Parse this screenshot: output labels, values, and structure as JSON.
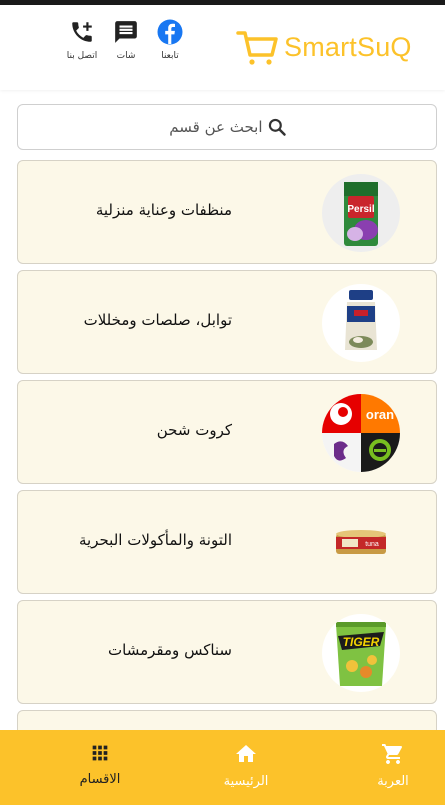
{
  "brand": {
    "name": "SmartSuQ",
    "color": "#fcc22a"
  },
  "header": {
    "actions": [
      {
        "label": "تابعنا",
        "icon": "facebook-icon"
      },
      {
        "label": "شات",
        "icon": "chat-icon"
      },
      {
        "label": "اتصل بنا",
        "icon": "add-call-icon"
      }
    ]
  },
  "search": {
    "placeholder": "ابحث عن قسم",
    "icon": "search-icon"
  },
  "categories": [
    {
      "name": "منظفات وعناية منزلية",
      "image": "detergent-bottle"
    },
    {
      "name": "توابل، صلصات ومخللات",
      "image": "spice-jar"
    },
    {
      "name": "كروت شحن",
      "image": "recharge-cards-logos"
    },
    {
      "name": "التونة والمأكولات البحرية",
      "image": "tuna-can"
    },
    {
      "name": "سناكس ومقرمشات",
      "image": "chips-bag"
    },
    {
      "name": "",
      "image": ""
    }
  ],
  "bottom_nav": [
    {
      "label": "الاقسام",
      "icon": "grid-icon",
      "active": true
    },
    {
      "label": "الرئيسية",
      "icon": "home-icon",
      "active": false
    },
    {
      "label": "العربة",
      "icon": "cart-icon",
      "active": false
    }
  ],
  "colors": {
    "accent": "#fcc22a",
    "card_bg": "#fcf8e8",
    "facebook": "#1877f2"
  }
}
